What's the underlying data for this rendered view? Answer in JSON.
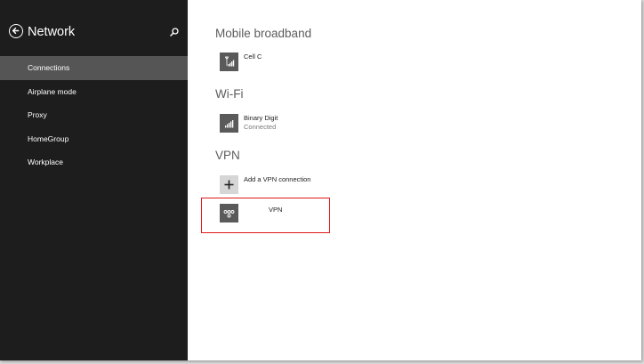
{
  "sidebar": {
    "title": "Network",
    "items": [
      {
        "label": "Connections",
        "selected": true
      },
      {
        "label": "Airplane mode",
        "selected": false
      },
      {
        "label": "Proxy",
        "selected": false
      },
      {
        "label": "HomeGroup",
        "selected": false
      },
      {
        "label": "Workplace",
        "selected": false
      }
    ]
  },
  "main": {
    "mobile_broadband": {
      "heading": "Mobile broadband",
      "connection": {
        "name": "Cell C",
        "icon": "cellular-signal-icon"
      }
    },
    "wifi": {
      "heading": "Wi-Fi",
      "connection": {
        "name": "Binary Digit",
        "status": "Connected",
        "icon": "wifi-signal-icon"
      }
    },
    "vpn": {
      "heading": "VPN",
      "add_label": "Add a VPN connection",
      "connection": {
        "name": "VPN",
        "icon": "vpn-icon"
      }
    }
  },
  "colors": {
    "sidebar_bg": "#1d1d1d",
    "selected_item_bg": "#555555",
    "tile_bg": "#5a5a5a",
    "highlight": "#e01818"
  }
}
